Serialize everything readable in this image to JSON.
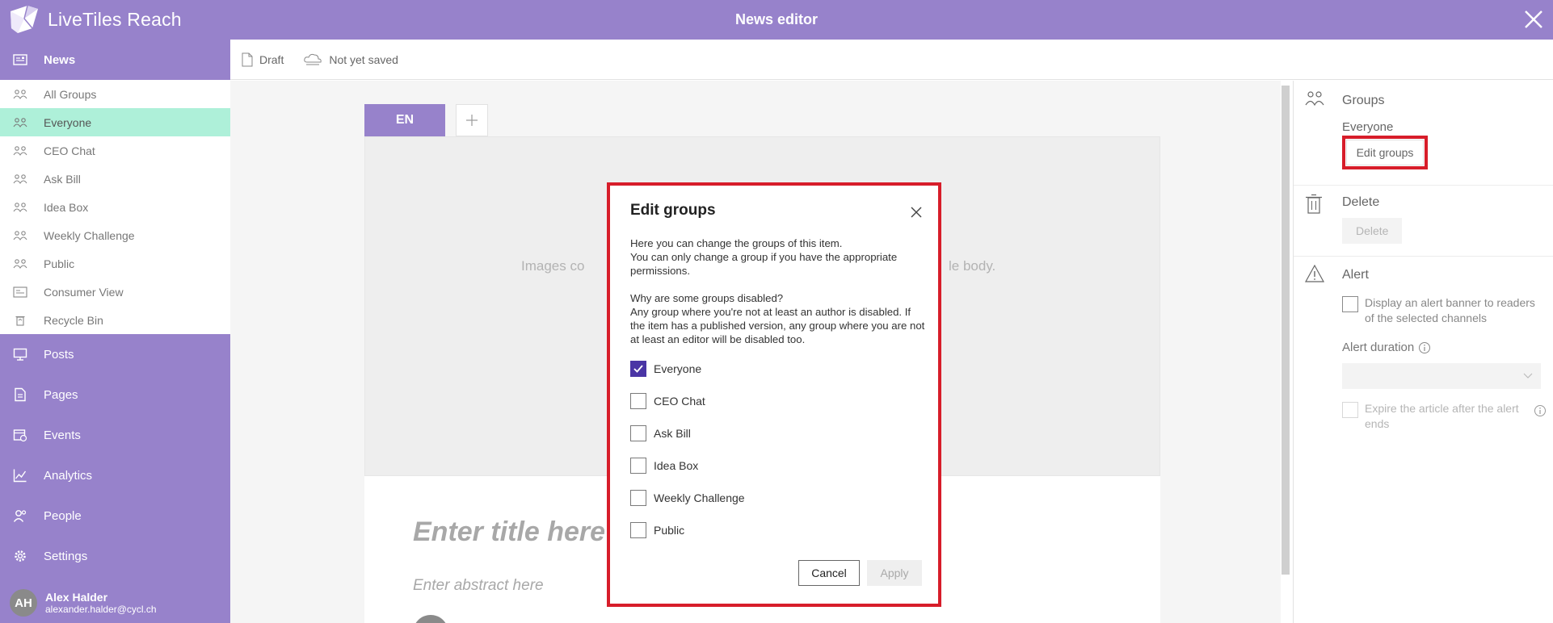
{
  "app": {
    "brand": "LiveTiles Reach",
    "title": "News editor"
  },
  "sidebar": {
    "news_label": "News",
    "sub_items": [
      {
        "label": "All Groups"
      },
      {
        "label": "Everyone"
      },
      {
        "label": "CEO Chat"
      },
      {
        "label": "Ask Bill"
      },
      {
        "label": "Idea Box"
      },
      {
        "label": "Weekly Challenge"
      },
      {
        "label": "Public"
      },
      {
        "label": "Consumer View"
      },
      {
        "label": "Recycle Bin"
      }
    ],
    "main_items": [
      {
        "label": "Posts",
        "icon": "posts-icon"
      },
      {
        "label": "Pages",
        "icon": "pages-icon"
      },
      {
        "label": "Events",
        "icon": "events-icon"
      },
      {
        "label": "Analytics",
        "icon": "analytics-icon"
      },
      {
        "label": "People",
        "icon": "people-icon"
      },
      {
        "label": "Settings",
        "icon": "settings-icon"
      }
    ],
    "user": {
      "initials": "AH",
      "name": "Alex Halder",
      "email": "alexander.halder@cycl.ch"
    }
  },
  "toolbar": {
    "status": "Draft",
    "save_state": "Not yet saved"
  },
  "editor": {
    "language_tab": "EN",
    "images_hint_left": "Images co",
    "images_hint_right": "le body.",
    "title_placeholder": "Enter title here",
    "abstract_placeholder": "Enter abstract here"
  },
  "right_panel": {
    "groups_title": "Groups",
    "groups_value": "Everyone",
    "edit_groups_label": "Edit groups",
    "delete_title": "Delete",
    "delete_button": "Delete",
    "alert_title": "Alert",
    "alert_banner_label": "Display an alert banner to readers of the selected channels",
    "alert_duration_label": "Alert duration",
    "expire_label": "Expire the article after the alert ends"
  },
  "modal": {
    "title": "Edit groups",
    "intro_line1": "Here you can change the groups of this item.",
    "intro_line2": "You can only change a group if you have the appropriate permissions.",
    "why_title": "Why are some groups disabled?",
    "why_text": "Any group where you're not at least an author is disabled. If the item has a published version, any group where you are not at least an editor will be disabled too.",
    "options": [
      {
        "label": "Everyone",
        "checked": true
      },
      {
        "label": "CEO Chat",
        "checked": false
      },
      {
        "label": "Ask Bill",
        "checked": false
      },
      {
        "label": "Idea Box",
        "checked": false
      },
      {
        "label": "Weekly Challenge",
        "checked": false
      },
      {
        "label": "Public",
        "checked": false
      }
    ],
    "cancel_label": "Cancel",
    "apply_label": "Apply"
  },
  "colors": {
    "brand": "#9782cb",
    "active_item": "#aef0d9",
    "checkbox_checked": "#4a35a5",
    "highlight": "#d71d2a"
  }
}
